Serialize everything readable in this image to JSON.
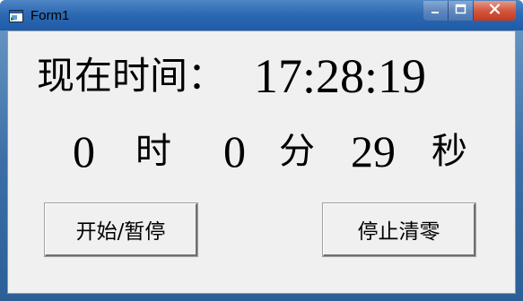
{
  "window": {
    "title": "Form1"
  },
  "titlebar_controls": {
    "minimize": "minimize-icon",
    "maximize": "maximize-icon",
    "close": "close-icon"
  },
  "clock": {
    "label": "现在时间：",
    "time": "17:28:19"
  },
  "elapsed": {
    "hours": "0",
    "hours_unit": "时",
    "minutes": "0",
    "minutes_unit": "分",
    "seconds": "29",
    "seconds_unit": "秒"
  },
  "buttons": {
    "start_pause": "开始/暂停",
    "stop_clear": "停止清零"
  },
  "colors": {
    "client_background": "#f0f0f0",
    "titlebar": "#2d6ab3",
    "close_button": "#c43a20"
  }
}
